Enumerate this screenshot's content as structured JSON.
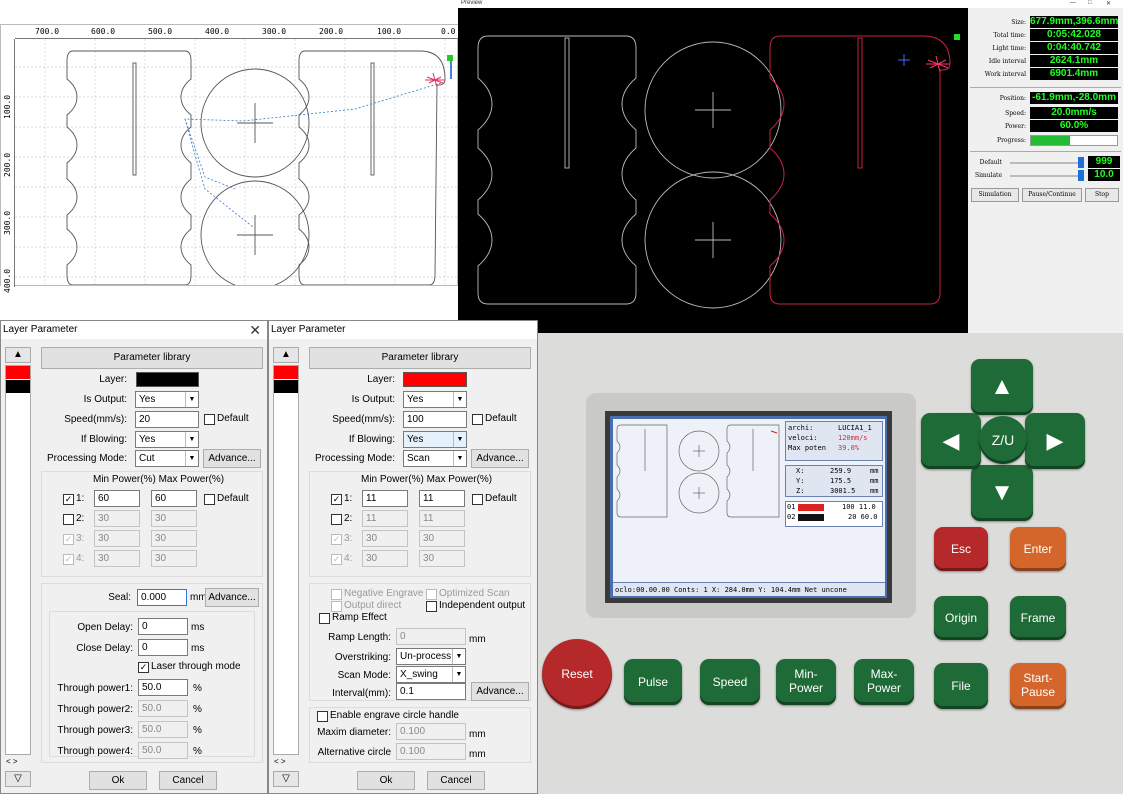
{
  "canvas": {
    "ruler_top_ticks": [
      "700.0",
      "600.0",
      "500.0",
      "400.0",
      "300.0",
      "200.0",
      "100.0",
      "0.0"
    ],
    "ruler_left_ticks": [
      "100.0",
      "200.0",
      "300.0",
      "400.0"
    ]
  },
  "preview": {
    "title": "Preview",
    "window_controls": [
      "—",
      "□",
      "✕"
    ],
    "stats": [
      {
        "label": "Size:",
        "value": "677.9mm,396.6mm"
      },
      {
        "label": "Total time:",
        "value": "0:05:42.028"
      },
      {
        "label": "Light time:",
        "value": "0:04:40.742"
      },
      {
        "label": "Idle interval",
        "value": "2624.1mm"
      },
      {
        "label": "Work interval",
        "value": "6901.4mm"
      }
    ],
    "live": [
      {
        "label": "Position:",
        "value": "-61.9mm,-28.0mm"
      },
      {
        "label": "Speed:",
        "value": "20.0mm/s"
      },
      {
        "label": "Power:",
        "value": "60.0%"
      }
    ],
    "progress_label": "Progress:",
    "progress": 0.45,
    "default_label": "Default",
    "default_value": "999",
    "simulate_label": "Simulate",
    "simulate_value": "10.0",
    "buttons": [
      "Simulation",
      "Pause/Continue",
      "Stop"
    ]
  },
  "dialog1": {
    "title": "Layer Parameter",
    "close": "✕",
    "param_library": "Parameter library",
    "layer_label": "Layer:",
    "layer_color": "#000000",
    "is_output_label": "Is Output:",
    "is_output": "Yes",
    "speed_label": "Speed(mm/s):",
    "speed": "20",
    "default_label": "Default",
    "if_blowing_label": "If Blowing:",
    "if_blowing": "Yes",
    "mode_label": "Processing Mode:",
    "mode": "Cut",
    "advance": "Advance...",
    "power_header": "Min Power(%) Max Power(%)",
    "powers": [
      {
        "label": "1:",
        "min": "60",
        "max": "60",
        "checked": true,
        "enabled": true
      },
      {
        "label": "2:",
        "min": "30",
        "max": "30",
        "checked": false,
        "enabled": true
      },
      {
        "label": "3:",
        "min": "30",
        "max": "30",
        "checked": true,
        "enabled": false
      },
      {
        "label": "4:",
        "min": "30",
        "max": "30",
        "checked": true,
        "enabled": false
      }
    ],
    "seal_label": "Seal:",
    "seal": "0.000",
    "mm": "mm",
    "open_delay_label": "Open Delay:",
    "open_delay": "0",
    "close_delay_label": "Close Delay:",
    "close_delay": "0",
    "ms": "ms",
    "laser_through": "Laser through mode",
    "through": [
      {
        "label": "Through power1:",
        "value": "50.0"
      },
      {
        "label": "Through power2:",
        "value": "50.0"
      },
      {
        "label": "Through power3:",
        "value": "50.0"
      },
      {
        "label": "Through power4:",
        "value": "50.0"
      }
    ],
    "pct": "%",
    "ok": "Ok",
    "cancel": "Cancel",
    "scroll_up": "▲",
    "scroll_down": "▽",
    "arrows": "< >"
  },
  "dialog2": {
    "title": "Layer Parameter",
    "param_library": "Parameter library",
    "layer_label": "Layer:",
    "layer_color": "#ff0000",
    "is_output_label": "Is Output:",
    "is_output": "Yes",
    "speed_label": "Speed(mm/s):",
    "speed": "100",
    "default_label": "Default",
    "if_blowing_label": "If Blowing:",
    "if_blowing": "Yes",
    "mode_label": "Processing Mode:",
    "mode": "Scan",
    "advance": "Advance...",
    "power_header": "Min Power(%) Max Power(%)",
    "powers": [
      {
        "label": "1:",
        "min": "11",
        "max": "11",
        "checked": true,
        "enabled": true
      },
      {
        "label": "2:",
        "min": "11",
        "max": "11",
        "checked": false,
        "enabled": true
      },
      {
        "label": "3:",
        "min": "30",
        "max": "30",
        "checked": true,
        "enabled": false
      },
      {
        "label": "4:",
        "min": "30",
        "max": "30",
        "checked": true,
        "enabled": false
      }
    ],
    "negative_engrave": "Negative Engrave",
    "optimized_scan": "Optimized Scan",
    "output_direct": "Output direct",
    "independent_output": "Independent output",
    "ramp_effect": "Ramp Effect",
    "ramp_length_label": "Ramp Length:",
    "ramp_length": "0",
    "mm": "mm",
    "overstriking_label": "Overstriking:",
    "overstriking": "Un-process",
    "scan_mode_label": "Scan Mode:",
    "scan_mode": "X_swing",
    "interval_label": "Interval(mm):",
    "interval": "0.1",
    "engrave_circle": "Enable engrave circle handle",
    "maxim_label": "Maxim diameter:",
    "maxim": "0.100",
    "alt_label": "Alternative circle",
    "alt": "0.100",
    "ok": "Ok",
    "cancel": "Cancel",
    "scroll_up": "▲",
    "scroll_down": "▽",
    "arrows": "< >"
  },
  "photo": {
    "lcd": {
      "archi_label": "archi:",
      "archi": "LUCIA1_1",
      "veloci_label": "veloci:",
      "veloci": "120mm/s",
      "maxpot_label": "Max poten",
      "maxpot": "39.0%",
      "x_label": "X:",
      "x": "259.9",
      "y_label": "Y:",
      "y": "175.5",
      "z_label": "Z:",
      "z": "3001.5",
      "unit": "mm",
      "layer1_no": "01",
      "layer1": "100 11.0",
      "layer2_no": "02",
      "layer2": "20 60.0",
      "status": "oclo:00.00.00 Conts:     1 X: 284.0mm Y: 104.4mm  Net uncone"
    },
    "keys": {
      "zu": "Z/U",
      "esc": "Esc",
      "enter": "Enter",
      "origin": "Origin",
      "frame": "Frame",
      "reset": "Reset",
      "pulse": "Pulse",
      "speed": "Speed",
      "min_power_1": "Min-",
      "min_power_2": "Power",
      "max_power_1": "Max-",
      "max_power_2": "Power",
      "file": "File",
      "start_1": "Start-",
      "start_2": "Pause"
    }
  }
}
